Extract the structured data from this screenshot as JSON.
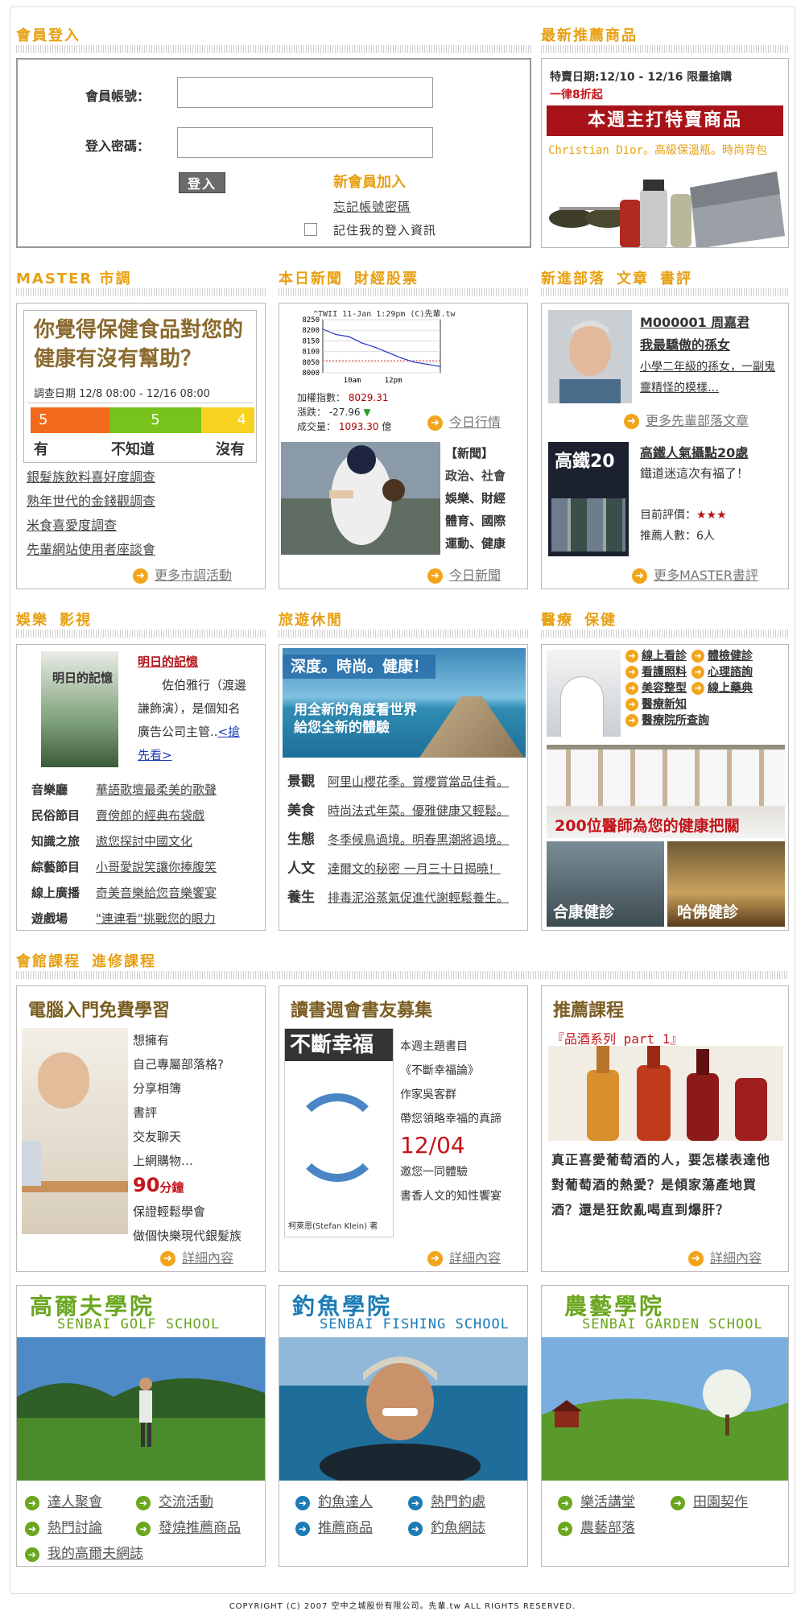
{
  "sections": {
    "login": "會員登入",
    "recommend": "最新推薦商品",
    "survey": "MASTER 市調",
    "news": [
      "本日新聞",
      "財經股票"
    ],
    "blog": [
      "新進部落",
      "文章",
      "書評"
    ],
    "ent": [
      "娛樂",
      "影視"
    ],
    "travel": "旅遊休閒",
    "medical": [
      "醫療",
      "保健"
    ],
    "course": [
      "會館課程",
      "進修課程"
    ]
  },
  "login": {
    "account_label": "會員帳號：",
    "password_label": "登入密碼：",
    "account_value": "",
    "password_value": "",
    "submit": "登入",
    "join": "新會員加入",
    "forgot": "忘記帳號密碼",
    "remember": "記住我的登入資訊"
  },
  "promo": {
    "dates": "特賣日期:12/10 - 12/16 限量搶購",
    "discount": "一律8折起",
    "banner": "本週主打特賣商品",
    "brand": "Christian Dior。高級保溫瓶。時尚背包"
  },
  "survey": {
    "question": "你覺得保健食品對您的健康有沒有幫助？",
    "date": "調查日期 12/8 08:00 - 12/16 08:00",
    "bars": [
      {
        "label": "有",
        "value": "5",
        "color": "#f26a1b"
      },
      {
        "label": "不知道",
        "value": "5",
        "color": "#77c21b"
      },
      {
        "label": "沒有",
        "value": "4",
        "color": "#f7d21f"
      }
    ],
    "links": [
      "銀髮族飲料喜好度調查",
      "熟年世代的金錢觀調查",
      "米食喜愛度調查",
      "先輩網站使用者座談會"
    ],
    "more": "更多市調活動"
  },
  "stock": {
    "header": "^TWII 11-Jan 1:29pm (C)先輩.tw",
    "y_ticks": [
      "8250",
      "8200",
      "8150",
      "8100",
      "8050",
      "8000"
    ],
    "x_ticks": [
      "10am",
      "12pm"
    ],
    "index_label": "加權指數：",
    "index": "8029.31",
    "change_label": "漲跌：",
    "change": "-27.96",
    "volume_label": "成交量：",
    "volume": "1093.30",
    "volume_unit": "億",
    "more": "今日行情",
    "chart_data": {
      "type": "line",
      "x": [
        "9:00",
        "9:30",
        "10:00",
        "10:30",
        "11:00",
        "11:30",
        "12:00",
        "12:30",
        "13:00",
        "13:29"
      ],
      "values": [
        8205,
        8180,
        8170,
        8140,
        8120,
        8095,
        8070,
        8050,
        8040,
        8029
      ],
      "ylim": [
        8000,
        8250
      ],
      "reference": 8057
    }
  },
  "news": {
    "heading": "【新聞】",
    "cats": [
      "政治、社會",
      "娛樂、財經",
      "體育、國際",
      "運動、健康"
    ],
    "more": "今日新聞"
  },
  "blog": {
    "id": "M000001 周嘉君",
    "title": "我最驕傲的孫女",
    "desc": "小學二年級的孫女，一副鬼靈精怪的模樣…",
    "more": "更多先輩部落文章",
    "book_cover": "高鐵20",
    "book_title": "高鐵人氣攝點20處",
    "book_desc": "鐵道迷這次有福了！",
    "rating_label": "目前評價：",
    "rating": 3,
    "rating_stars": "★★★",
    "rec_label": "推薦人數：",
    "rec_count": "6人",
    "book_more": "更多MASTER書評"
  },
  "ent": {
    "poster_title": "明日的記憶",
    "title": "明日的記憶",
    "desc": "佐伯雅行（渡邊謙飾演），是個知名廣告公司主管..",
    "watch": "<搶先看>",
    "rows": [
      {
        "cat": "音樂廳",
        "text": "華語歌壇最柔美的歌聲"
      },
      {
        "cat": "民俗節目",
        "text": "賣傍郎的經典布袋戲"
      },
      {
        "cat": "知識之旅",
        "text": "遨您探討中國文化"
      },
      {
        "cat": "綜藝節目",
        "text": "小哥愛說笑讓你捧腹笑"
      },
      {
        "cat": "線上廣播",
        "text": "奇美音樂給您音樂饗宴"
      },
      {
        "cat": "遊戲場",
        "text": "\"連連看\"挑戰您的眼力"
      }
    ]
  },
  "travel": {
    "tagline": "深度。時尚。健康！",
    "sub1": "用全新的角度看世界",
    "sub2": "給您全新的體驗",
    "rows": [
      {
        "cat": "景觀",
        "text": "阿里山櫻花季。賞櫻賞當品佳肴。"
      },
      {
        "cat": "美食",
        "text": "時尚法式年菜。優雅健康又輕鬆。"
      },
      {
        "cat": "生態",
        "text": "冬季候鳥過境。明春黑潮將過境。"
      },
      {
        "cat": "人文",
        "text": "達爾文的秘密 一月三十日揭曉！"
      },
      {
        "cat": "養生",
        "text": "排毒泥浴蒸氣促進代謝輕鬆養生。"
      }
    ]
  },
  "medical": {
    "links": [
      "線上看診",
      "體檢健診",
      "看護照料",
      "心理諮詢",
      "美容整型",
      "線上藥典",
      "醫療新知",
      "醫療院所查詢"
    ],
    "doctors": "200位醫師為您的健康把關",
    "clinic1": "合康健診",
    "clinic2": "哈佛健診"
  },
  "course1": {
    "title": "電腦入門免費學習",
    "lines": [
      "想擁有",
      "自己專屬部落格?",
      "分享相簿",
      "書評",
      "交友聊天",
      "上網購物…"
    ],
    "minutes": "90",
    "min_unit": "分鐘",
    "tail1": "保證輕鬆學會",
    "tail2": "做個快樂現代銀髮族",
    "more": "詳細內容"
  },
  "course2": {
    "title": "讀書週會書友募集",
    "book": "不斷幸福",
    "author": "柯萊恩(Stefan Klein) 著",
    "lines": [
      "本週主題書目",
      "《不斷幸福論》",
      "作家吳客群",
      "帶您領略幸福的真諦"
    ],
    "date": "12/04",
    "tail1": "邀您一同體驗",
    "tail2": "書香人文的知性饗宴",
    "more": "詳細內容"
  },
  "course3": {
    "title": "推薦課程",
    "series": "『品酒系列 part 1』",
    "text": "真正喜愛葡萄酒的人，要怎樣表達他對葡萄酒的熱愛？是傾家蕩產地買酒？還是狂飲亂喝直到爆肝？",
    "more": "詳細內容"
  },
  "schools": [
    {
      "title": "高爾夫學院",
      "sub": "SENBAI GOLF SCHOOL",
      "color": "#6aa61e",
      "links": [
        "達人聚會",
        "交流活動",
        "熱門討論",
        "發燒推薦商品",
        "我的高爾夫網誌"
      ]
    },
    {
      "title": "釣魚學院",
      "sub": "SENBAI FISHING SCHOOL",
      "color": "#1b7bb5",
      "links": [
        "釣魚達人",
        "熱門釣處",
        "推薦商品",
        "釣魚網誌"
      ]
    },
    {
      "title": "農藝學院",
      "sub": "SENBAI GARDEN SCHOOL",
      "color": "#6aa61e",
      "links": [
        "樂活講堂",
        "田園契作",
        "農藝部落"
      ]
    }
  ],
  "footer": "COPYRIGHT (C) 2007 空中之城股份有限公司。先輩.tw ALL RIGHTS RESERVED."
}
